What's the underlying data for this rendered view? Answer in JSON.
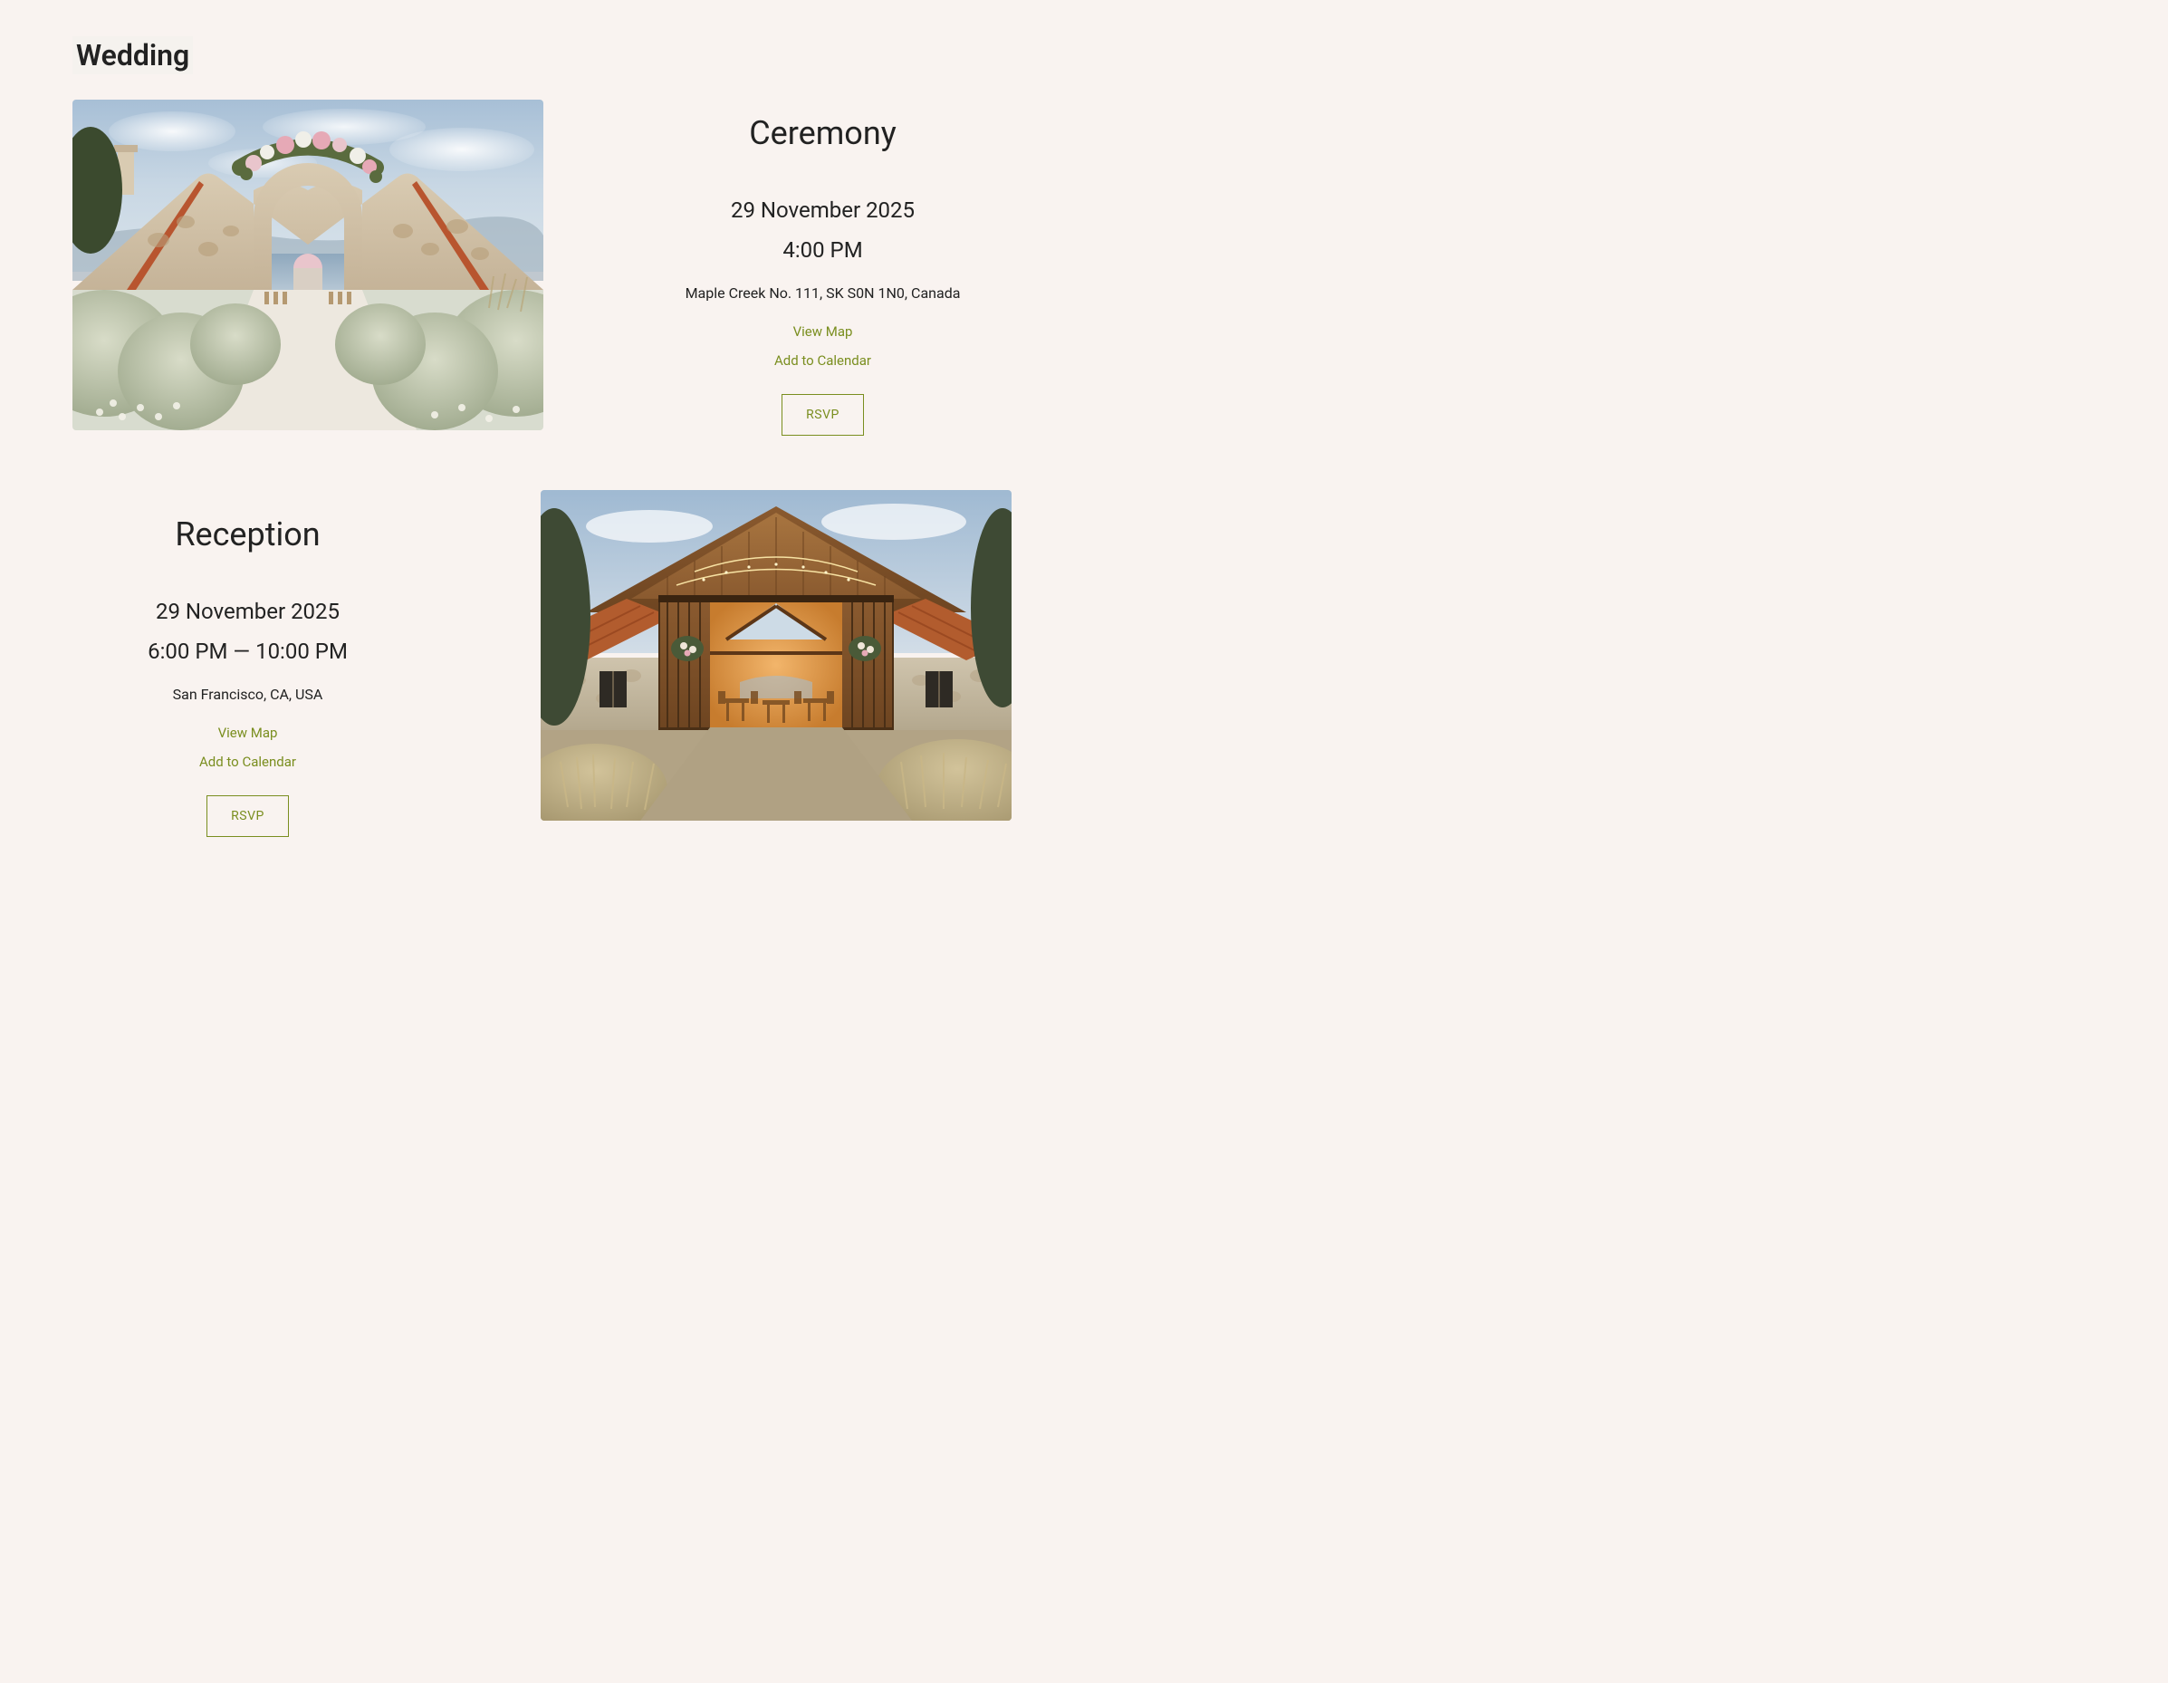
{
  "page": {
    "title": "Wedding"
  },
  "events": {
    "ceremony": {
      "title": "Ceremony",
      "date": "29 November 2025",
      "time": "4:00 PM",
      "location": "Maple Creek No. 111, SK S0N 1N0, Canada",
      "view_map_label": "View Map",
      "add_calendar_label": "Add to Calendar",
      "rsvp_label": "RSVP"
    },
    "reception": {
      "title": "Reception",
      "date": "29 November 2025",
      "time": "6:00 PM — 10:00 PM",
      "location": "San Francisco, CA, USA",
      "view_map_label": "View Map",
      "add_calendar_label": "Add to Calendar",
      "rsvp_label": "RSVP"
    }
  },
  "colors": {
    "background": "#f9f3f0",
    "accent": "#7a8e1f",
    "text": "#222222"
  }
}
